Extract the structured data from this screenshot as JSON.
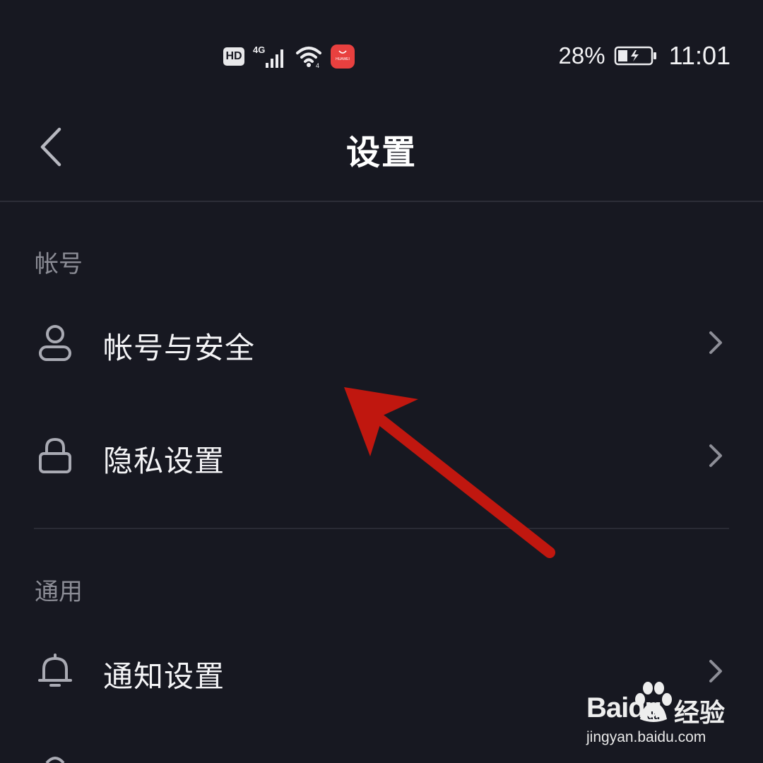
{
  "status_bar": {
    "hd_badge": "HD",
    "network_type": "4G",
    "battery_percent": "28%",
    "time": "11:01",
    "appgallery_label": "HUAWEI",
    "icons": [
      "hd-icon",
      "cellular-4g-icon",
      "wifi-icon",
      "huawei-appgallery-icon",
      "battery-charging-icon"
    ]
  },
  "header": {
    "title": "设置",
    "back_icon": "chevron-left-icon"
  },
  "sections": [
    {
      "label": "帐号",
      "items": [
        {
          "label": "帐号与安全",
          "icon": "person-icon"
        },
        {
          "label": "隐私设置",
          "icon": "lock-icon"
        }
      ]
    },
    {
      "label": "通用",
      "items": [
        {
          "label": "通知设置",
          "icon": "bell-icon"
        }
      ]
    }
  ],
  "annotation": {
    "type": "arrow",
    "color": "#c0170f"
  },
  "watermark": {
    "brand": "Baidu",
    "product": "经验",
    "url": "jingyan.baidu.com"
  },
  "colors": {
    "background": "#171821",
    "text_primary": "#f4f4f6",
    "text_secondary": "#8b8c95",
    "divider": "#2a2b35",
    "accent_red": "#c0170f"
  }
}
